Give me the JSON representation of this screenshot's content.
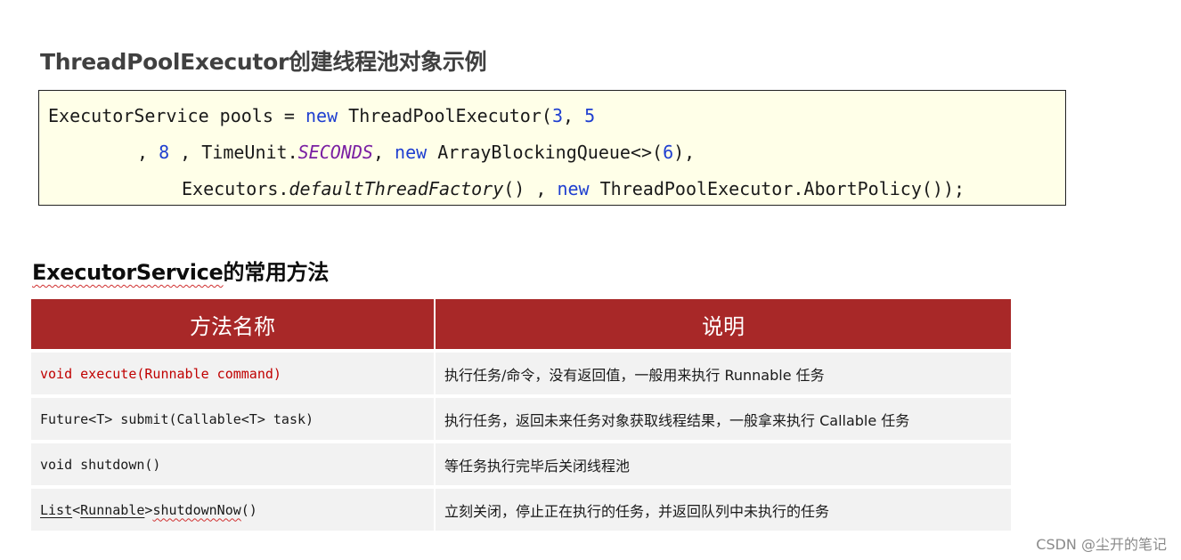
{
  "heading1": "ThreadPoolExecutor创建线程池对象示例",
  "code": {
    "line1": {
      "a": "ExecutorService pools = ",
      "kw": "new",
      "b": " ThreadPoolExecutor(",
      "n1": "3",
      "c": ", ",
      "n2": "5"
    },
    "line2": {
      "a": ", ",
      "n1": "8",
      "b": " , TimeUnit.",
      "const": "SECONDS",
      "c": ", ",
      "kw": "new",
      "d": " ArrayBlockingQueue<>(",
      "n2": "6",
      "e": "),"
    },
    "line3": {
      "a": "Executors.",
      "method": "defaultThreadFactory",
      "b": "() , ",
      "kw": "new",
      "c": " ThreadPoolExecutor.AbortPolicy());"
    }
  },
  "heading2": {
    "en": "ExecutorService",
    "cn": "的常用方法"
  },
  "table": {
    "headers": [
      "方法名称",
      "说明"
    ],
    "rows": [
      {
        "method": "void execute(Runnable command)",
        "desc": "执行任务/命令，没有返回值，一般用来执行 Runnable 任务"
      },
      {
        "method": "Future<T> submit(Callable<T> task)",
        "desc": "执行任务，返回未来任务对象获取线程结果，一般拿来执行 Callable 任务"
      },
      {
        "method": "void shutdown()",
        "desc": "等任务执行完毕后关闭线程池"
      },
      {
        "method_parts": {
          "p1": "List",
          "p2": "<",
          "p3": "Runnable",
          "p4": "> ",
          "p5": "shutdownNow",
          "p6": "()"
        },
        "desc": "立刻关闭，停止正在执行的任务，并返回队列中未执行的任务"
      }
    ]
  },
  "watermark": "CSDN @尘开的笔记",
  "colors": {
    "header_bg": "#a82828",
    "code_bg": "#ffffe8",
    "keyword": "#1f3fd0",
    "constant": "#7a1fa2",
    "row_bg": "#f2f2f2",
    "highlight_red": "#c00000"
  }
}
